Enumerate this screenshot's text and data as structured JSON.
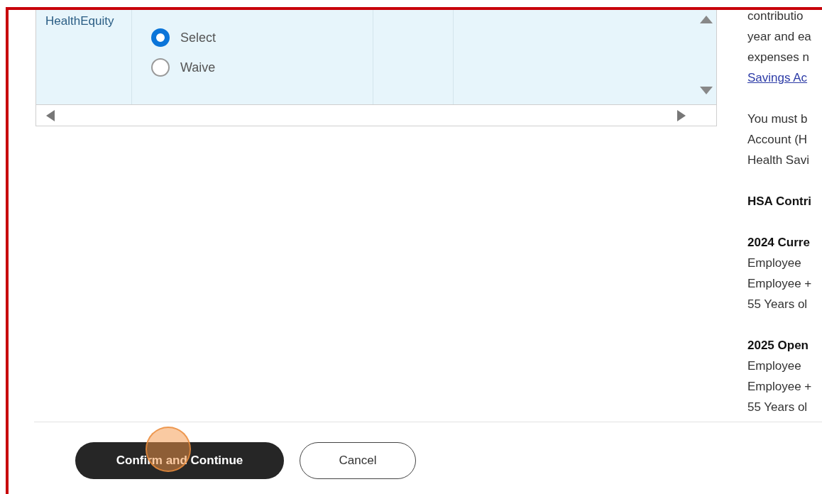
{
  "table": {
    "rows": [
      {
        "provider": "HealthEquity",
        "options": [
          {
            "label": "Select",
            "selected": true
          },
          {
            "label": "Waive",
            "selected": false
          }
        ]
      }
    ]
  },
  "info_panel": {
    "paragraphs": [
      {
        "lines": [
          {
            "kind": "text",
            "text": "contributio"
          },
          {
            "kind": "text",
            "text": "year and ea"
          },
          {
            "kind": "text",
            "text": "expenses n"
          },
          {
            "kind": "link",
            "text": "Savings Ac"
          }
        ]
      },
      {
        "lines": [
          {
            "kind": "text",
            "text": "You must b"
          },
          {
            "kind": "text",
            "text": "Account (H"
          },
          {
            "kind": "text",
            "text": "Health Savi"
          }
        ]
      },
      {
        "lines": [
          {
            "kind": "heading",
            "text": "HSA Contri"
          }
        ]
      },
      {
        "lines": [
          {
            "kind": "heading",
            "text": "2024 Curre"
          },
          {
            "kind": "text",
            "text": "Employee"
          },
          {
            "kind": "text",
            "text": "Employee +"
          },
          {
            "kind": "text",
            "text": "55 Years ol"
          }
        ]
      },
      {
        "lines": [
          {
            "kind": "heading",
            "text": "2025 Open"
          },
          {
            "kind": "text",
            "text": "Employee"
          },
          {
            "kind": "text",
            "text": "Employee +"
          },
          {
            "kind": "text",
            "text": "55 Years ol"
          }
        ]
      }
    ]
  },
  "buttons": [
    {
      "kind": "primary",
      "label": "Confirm and Continue"
    },
    {
      "kind": "secondary",
      "label": "Cancel"
    }
  ]
}
